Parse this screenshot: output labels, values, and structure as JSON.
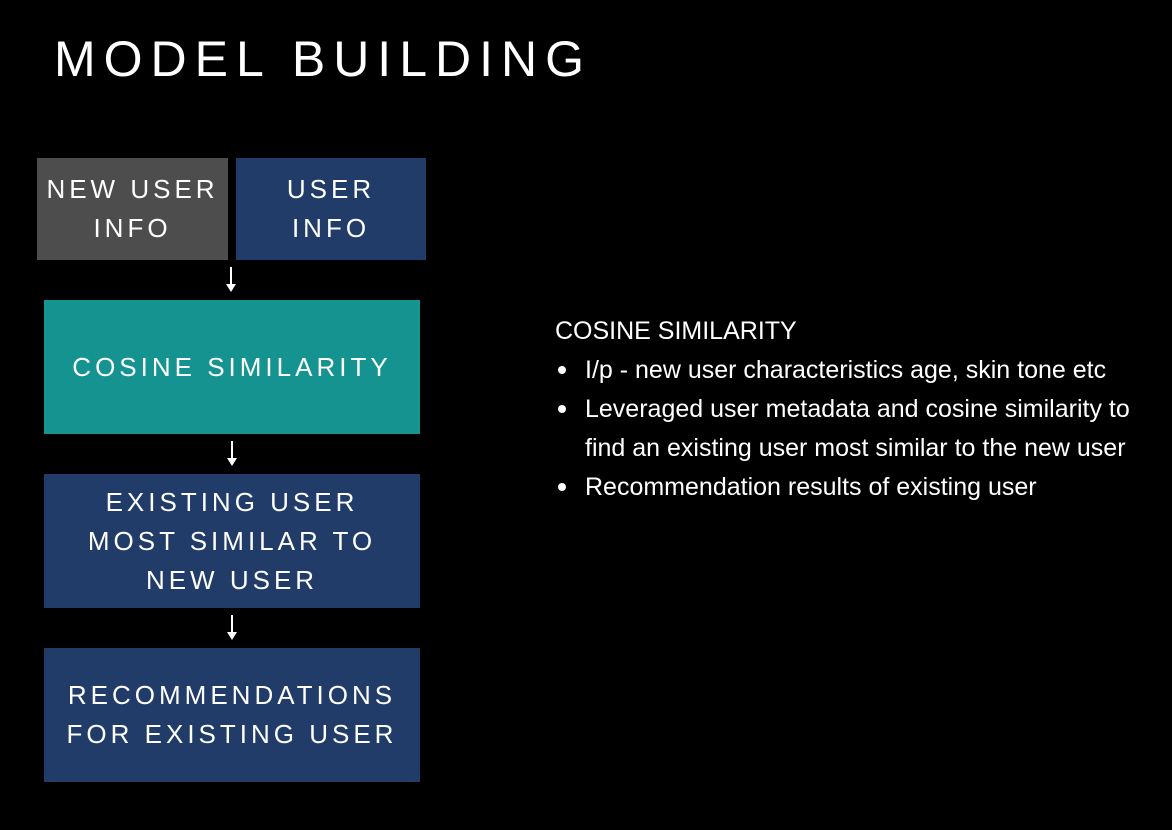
{
  "title": "MODEL BUILDING",
  "colors": {
    "background": "#000000",
    "gray_box": "#4d4d4d",
    "navy_box": "#213c69",
    "teal_box": "#149391",
    "text": "#ffffff"
  },
  "flowchart": {
    "new_user_info": "NEW USER\nINFO",
    "user_info": "USER\nINFO",
    "cosine_similarity": "COSINE SIMILARITY",
    "existing_user": "EXISTING USER\nMOST SIMILAR TO\nNEW USER",
    "recommendations": "RECOMMENDATIONS\nFOR EXISTING USER"
  },
  "panel": {
    "heading": "COSINE SIMILARITY",
    "bullets": [
      "I/p - new user characteristics age, skin tone etc",
      "Leveraged user metadata and cosine similarity to find an existing user most similar to the new user",
      "Recommendation results of existing user"
    ]
  }
}
